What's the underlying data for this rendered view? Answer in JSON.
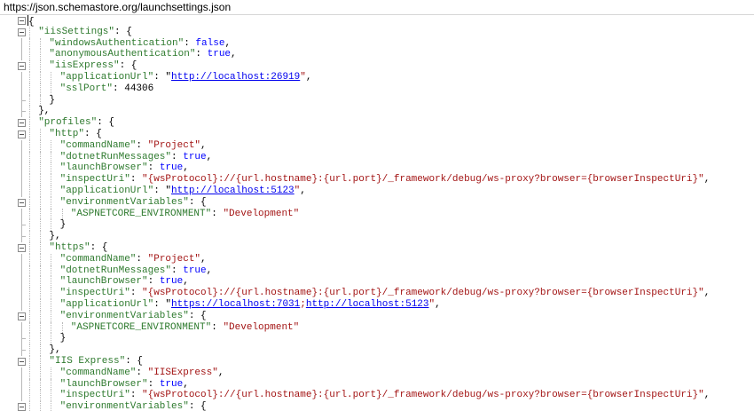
{
  "url_bar": {
    "url": "https://json.schemastore.org/launchsettings.json"
  },
  "json_lines": [
    {
      "indent": 0,
      "fold": "open",
      "tokens": [
        {
          "t": "cursor",
          "v": ""
        },
        {
          "t": "p",
          "v": "{"
        }
      ]
    },
    {
      "indent": 1,
      "fold": "open",
      "tokens": [
        {
          "t": "k",
          "v": "\"iisSettings\""
        },
        {
          "t": "p",
          "v": ": {"
        }
      ]
    },
    {
      "indent": 2,
      "fold": "none",
      "tokens": [
        {
          "t": "k",
          "v": "\"windowsAuthentication\""
        },
        {
          "t": "p",
          "v": ": "
        },
        {
          "t": "kw",
          "v": "false"
        },
        {
          "t": "p",
          "v": ","
        }
      ]
    },
    {
      "indent": 2,
      "fold": "none",
      "tokens": [
        {
          "t": "k",
          "v": "\"anonymousAuthentication\""
        },
        {
          "t": "p",
          "v": ": "
        },
        {
          "t": "kw",
          "v": "true"
        },
        {
          "t": "p",
          "v": ","
        }
      ]
    },
    {
      "indent": 2,
      "fold": "open",
      "tokens": [
        {
          "t": "k",
          "v": "\"iisExpress\""
        },
        {
          "t": "p",
          "v": ": {"
        }
      ]
    },
    {
      "indent": 3,
      "fold": "none",
      "tokens": [
        {
          "t": "k",
          "v": "\"applicationUrl\""
        },
        {
          "t": "p",
          "v": ": \""
        },
        {
          "t": "link",
          "v": "http://localhost:26919"
        },
        {
          "t": "s",
          "v": "\""
        },
        {
          "t": "p",
          "v": ","
        }
      ]
    },
    {
      "indent": 3,
      "fold": "none",
      "tokens": [
        {
          "t": "k",
          "v": "\"sslPort\""
        },
        {
          "t": "p",
          "v": ": "
        },
        {
          "t": "n",
          "v": "44306"
        }
      ]
    },
    {
      "indent": 2,
      "fold": "end",
      "tokens": [
        {
          "t": "p",
          "v": "}"
        }
      ]
    },
    {
      "indent": 1,
      "fold": "end",
      "tokens": [
        {
          "t": "p",
          "v": "},"
        }
      ]
    },
    {
      "indent": 1,
      "fold": "open",
      "tokens": [
        {
          "t": "k",
          "v": "\"profiles\""
        },
        {
          "t": "p",
          "v": ": {"
        }
      ]
    },
    {
      "indent": 2,
      "fold": "open",
      "tokens": [
        {
          "t": "k",
          "v": "\"http\""
        },
        {
          "t": "p",
          "v": ": {"
        }
      ]
    },
    {
      "indent": 3,
      "fold": "none",
      "tokens": [
        {
          "t": "k",
          "v": "\"commandName\""
        },
        {
          "t": "p",
          "v": ": "
        },
        {
          "t": "s",
          "v": "\"Project\""
        },
        {
          "t": "p",
          "v": ","
        }
      ]
    },
    {
      "indent": 3,
      "fold": "none",
      "tokens": [
        {
          "t": "k",
          "v": "\"dotnetRunMessages\""
        },
        {
          "t": "p",
          "v": ": "
        },
        {
          "t": "kw",
          "v": "true"
        },
        {
          "t": "p",
          "v": ","
        }
      ]
    },
    {
      "indent": 3,
      "fold": "none",
      "tokens": [
        {
          "t": "k",
          "v": "\"launchBrowser\""
        },
        {
          "t": "p",
          "v": ": "
        },
        {
          "t": "kw",
          "v": "true"
        },
        {
          "t": "p",
          "v": ","
        }
      ]
    },
    {
      "indent": 3,
      "fold": "none",
      "tokens": [
        {
          "t": "k",
          "v": "\"inspectUri\""
        },
        {
          "t": "p",
          "v": ": "
        },
        {
          "t": "s",
          "v": "\"{wsProtocol}://{url.hostname}:{url.port}/_framework/debug/ws-proxy?browser={browserInspectUri}\""
        },
        {
          "t": "p",
          "v": ","
        }
      ]
    },
    {
      "indent": 3,
      "fold": "none",
      "tokens": [
        {
          "t": "k",
          "v": "\"applicationUrl\""
        },
        {
          "t": "p",
          "v": ": \""
        },
        {
          "t": "link",
          "v": "http://localhost:5123"
        },
        {
          "t": "s",
          "v": "\""
        },
        {
          "t": "p",
          "v": ","
        }
      ]
    },
    {
      "indent": 3,
      "fold": "open",
      "tokens": [
        {
          "t": "k",
          "v": "\"environmentVariables\""
        },
        {
          "t": "p",
          "v": ": {"
        }
      ]
    },
    {
      "indent": 4,
      "fold": "none",
      "tokens": [
        {
          "t": "k",
          "v": "\"ASPNETCORE_ENVIRONMENT\""
        },
        {
          "t": "p",
          "v": ": "
        },
        {
          "t": "s",
          "v": "\"Development\""
        }
      ]
    },
    {
      "indent": 3,
      "fold": "end",
      "tokens": [
        {
          "t": "p",
          "v": "}"
        }
      ]
    },
    {
      "indent": 2,
      "fold": "end",
      "tokens": [
        {
          "t": "p",
          "v": "},"
        }
      ]
    },
    {
      "indent": 2,
      "fold": "open",
      "tokens": [
        {
          "t": "k",
          "v": "\"https\""
        },
        {
          "t": "p",
          "v": ": {"
        }
      ]
    },
    {
      "indent": 3,
      "fold": "none",
      "tokens": [
        {
          "t": "k",
          "v": "\"commandName\""
        },
        {
          "t": "p",
          "v": ": "
        },
        {
          "t": "s",
          "v": "\"Project\""
        },
        {
          "t": "p",
          "v": ","
        }
      ]
    },
    {
      "indent": 3,
      "fold": "none",
      "tokens": [
        {
          "t": "k",
          "v": "\"dotnetRunMessages\""
        },
        {
          "t": "p",
          "v": ": "
        },
        {
          "t": "kw",
          "v": "true"
        },
        {
          "t": "p",
          "v": ","
        }
      ]
    },
    {
      "indent": 3,
      "fold": "none",
      "tokens": [
        {
          "t": "k",
          "v": "\"launchBrowser\""
        },
        {
          "t": "p",
          "v": ": "
        },
        {
          "t": "kw",
          "v": "true"
        },
        {
          "t": "p",
          "v": ","
        }
      ]
    },
    {
      "indent": 3,
      "fold": "none",
      "tokens": [
        {
          "t": "k",
          "v": "\"inspectUri\""
        },
        {
          "t": "p",
          "v": ": "
        },
        {
          "t": "s",
          "v": "\"{wsProtocol}://{url.hostname}:{url.port}/_framework/debug/ws-proxy?browser={browserInspectUri}\""
        },
        {
          "t": "p",
          "v": ","
        }
      ]
    },
    {
      "indent": 3,
      "fold": "none",
      "tokens": [
        {
          "t": "k",
          "v": "\"applicationUrl\""
        },
        {
          "t": "p",
          "v": ": \""
        },
        {
          "t": "link",
          "v": "https://localhost:7031"
        },
        {
          "t": "s",
          "v": ";"
        },
        {
          "t": "link",
          "v": "http://localhost:5123"
        },
        {
          "t": "s",
          "v": "\""
        },
        {
          "t": "p",
          "v": ","
        }
      ]
    },
    {
      "indent": 3,
      "fold": "open",
      "tokens": [
        {
          "t": "k",
          "v": "\"environmentVariables\""
        },
        {
          "t": "p",
          "v": ": {"
        }
      ]
    },
    {
      "indent": 4,
      "fold": "none",
      "tokens": [
        {
          "t": "k",
          "v": "\"ASPNETCORE_ENVIRONMENT\""
        },
        {
          "t": "p",
          "v": ": "
        },
        {
          "t": "s",
          "v": "\"Development\""
        }
      ]
    },
    {
      "indent": 3,
      "fold": "end",
      "tokens": [
        {
          "t": "p",
          "v": "}"
        }
      ]
    },
    {
      "indent": 2,
      "fold": "end",
      "tokens": [
        {
          "t": "p",
          "v": "},"
        }
      ]
    },
    {
      "indent": 2,
      "fold": "open",
      "tokens": [
        {
          "t": "k",
          "v": "\"IIS Express\""
        },
        {
          "t": "p",
          "v": ": {"
        }
      ]
    },
    {
      "indent": 3,
      "fold": "none",
      "tokens": [
        {
          "t": "k",
          "v": "\"commandName\""
        },
        {
          "t": "p",
          "v": ": "
        },
        {
          "t": "s",
          "v": "\"IISExpress\""
        },
        {
          "t": "p",
          "v": ","
        }
      ]
    },
    {
      "indent": 3,
      "fold": "none",
      "tokens": [
        {
          "t": "k",
          "v": "\"launchBrowser\""
        },
        {
          "t": "p",
          "v": ": "
        },
        {
          "t": "kw",
          "v": "true"
        },
        {
          "t": "p",
          "v": ","
        }
      ]
    },
    {
      "indent": 3,
      "fold": "none",
      "tokens": [
        {
          "t": "k",
          "v": "\"inspectUri\""
        },
        {
          "t": "p",
          "v": ": "
        },
        {
          "t": "s",
          "v": "\"{wsProtocol}://{url.hostname}:{url.port}/_framework/debug/ws-proxy?browser={browserInspectUri}\""
        },
        {
          "t": "p",
          "v": ","
        }
      ]
    },
    {
      "indent": 3,
      "fold": "open",
      "tokens": [
        {
          "t": "k",
          "v": "\"environmentVariables\""
        },
        {
          "t": "p",
          "v": ": {"
        }
      ]
    }
  ],
  "colors": {
    "key": "#2e7a2e",
    "string": "#a31515",
    "keyword": "#0000ff",
    "link": "#0000ee"
  }
}
